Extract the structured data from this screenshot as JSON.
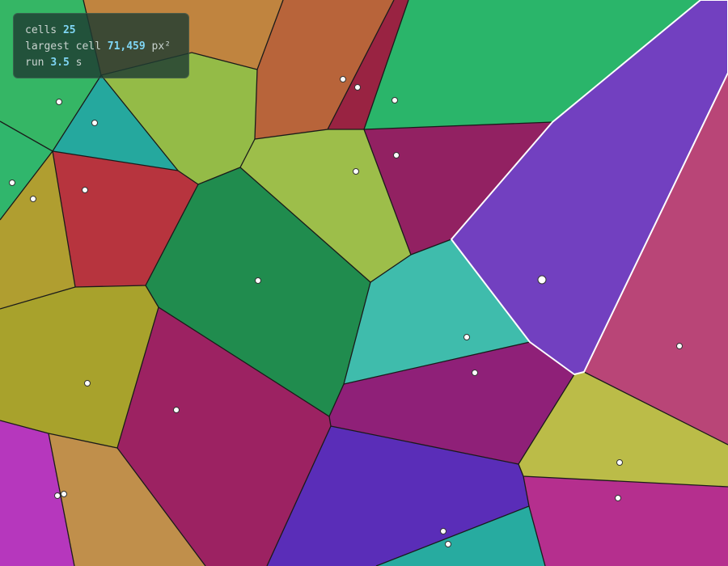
{
  "hud": {
    "cells_label": "cells",
    "cells_value": "25",
    "largest_label": "largest cell",
    "largest_value": "71,459",
    "largest_unit": "px²",
    "run_label": "run",
    "run_value": "3.5",
    "run_unit": "s"
  },
  "colors": {
    "cell_border": "#1a1a1a",
    "highlight_border": "#ffffff",
    "site_fill": "#ffffff",
    "site_stroke": "#333333"
  }
}
